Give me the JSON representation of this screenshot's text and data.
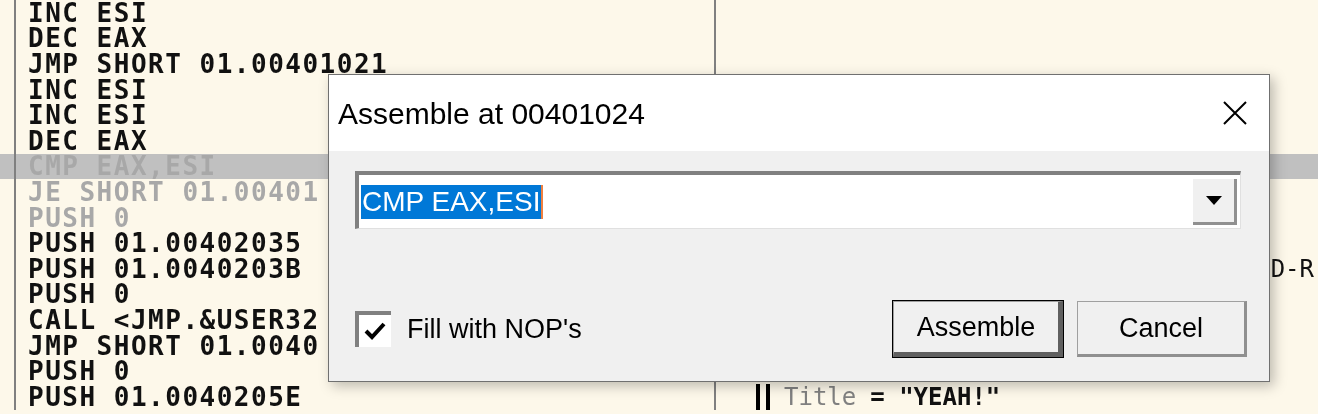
{
  "listing": {
    "rows": [
      {
        "instruction": "INC ESI",
        "selected": false,
        "dimmed": false
      },
      {
        "instruction": "DEC EAX",
        "selected": false,
        "dimmed": false
      },
      {
        "instruction": "JMP SHORT 01.00401021",
        "selected": false,
        "dimmed": false
      },
      {
        "instruction": "INC ESI",
        "selected": false,
        "dimmed": false
      },
      {
        "instruction": "INC ESI",
        "selected": false,
        "dimmed": false
      },
      {
        "instruction": "DEC EAX",
        "selected": false,
        "dimmed": false
      },
      {
        "instruction": "CMP EAX,ESI",
        "selected": true,
        "dimmed": true
      },
      {
        "instruction": "JE SHORT 01.00401",
        "selected": false,
        "dimmed": true
      },
      {
        "instruction": "PUSH 0",
        "selected": false,
        "dimmed": true
      },
      {
        "instruction": "PUSH 01.00402035",
        "selected": false,
        "dimmed": false
      },
      {
        "instruction": "PUSH 01.0040203B",
        "selected": false,
        "dimmed": false,
        "comment": "D-R"
      },
      {
        "instruction": "PUSH 0",
        "selected": false,
        "dimmed": false
      },
      {
        "instruction": "CALL <JMP.&USER32",
        "selected": false,
        "dimmed": false
      },
      {
        "instruction": "JMP SHORT 01.0040",
        "selected": false,
        "dimmed": false
      },
      {
        "instruction": "PUSH 0",
        "selected": false,
        "dimmed": false
      },
      {
        "instruction": "PUSH 01.0040205E",
        "selected": false,
        "dimmed": false,
        "comment_label": "Title",
        "comment": "= \"YEAH!\""
      }
    ]
  },
  "dialog": {
    "title": "Assemble at 00401024",
    "combo_value": "CMP EAX,ESI",
    "fill_checkbox": {
      "label": "Fill with NOP's",
      "checked": true
    },
    "buttons": [
      {
        "label": "Assemble",
        "default": true
      },
      {
        "label": "Cancel",
        "default": false
      }
    ]
  }
}
